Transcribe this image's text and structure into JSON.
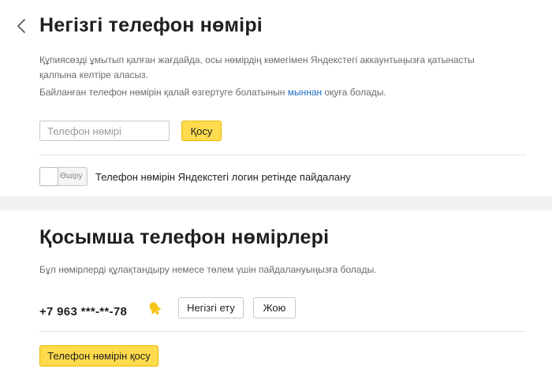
{
  "main_phone": {
    "title": "Негізгі телефон нөмірі",
    "description": "Құпиясөзді ұмытып қалған жағдайда, осы нөмірдің көмегімен Яндекстегі аккаунтыңызға қатынасты қалпына келтіре аласыз.",
    "change_info_prefix": "Байланған телефон нөмірін қалай өзгертуге болатынын ",
    "change_info_link": "мыннан",
    "change_info_suffix": " оқуға болады.",
    "phone_input_placeholder": "Телефон нөмірі",
    "phone_input_value": "",
    "add_button": "Қосу",
    "toggle_state_label": "Өшіру",
    "toggle_description": "Телефон нөмірін Яндекстегі логин ретінде пайдалану"
  },
  "additional_phones": {
    "title": "Қосымша телефон нөмірлері",
    "description": "Бұл нөмірлерді құлақтандыру немесе төлем үшін пайдалануыңызға болады.",
    "phones": [
      {
        "number": "+7 963 ***-**-78",
        "make_main_button": "Негізгі ету",
        "delete_button": "Жою"
      }
    ],
    "add_phone_button": "Телефон нөмірін қосу"
  },
  "colors": {
    "accent_yellow": "#ffdb4d",
    "link_blue": "#1a6ec5",
    "bell_yellow": "#f5c518"
  },
  "icons": {
    "back": "chevron-left-icon",
    "notification": "bell-icon"
  }
}
